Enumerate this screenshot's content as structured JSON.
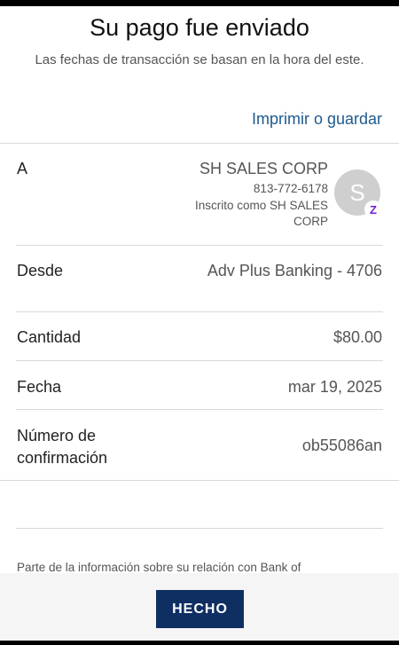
{
  "header": {
    "title": "Su pago fue enviado",
    "subtitle": "Las fechas de transacción se basan en la hora del este."
  },
  "actions": {
    "print_label": "Imprimir o guardar",
    "done_label": "HECHO"
  },
  "details": {
    "recipient": {
      "label": "A",
      "name": "SH SALES CORP",
      "phone": "813-772-6178",
      "enrolled_line1": "Inscrito como SH SALES",
      "enrolled_line2": "CORP",
      "avatar_initial": "S",
      "badge_letter": "Z"
    },
    "from": {
      "label": "Desde",
      "value": "Adv Plus Banking - 4706"
    },
    "amount": {
      "label": "Cantidad",
      "value": "$80.00"
    },
    "date": {
      "label": "Fecha",
      "value": "mar 19, 2025"
    },
    "confirmation": {
      "label_line1": "Número de",
      "label_line2": "confirmación",
      "value": "ob55086an"
    }
  },
  "disclaimer": "Parte de la información sobre su relación con Bank of",
  "colors": {
    "link": "#1e5a8e",
    "button": "#0f2f63",
    "zelle": "#6d1ed4",
    "avatar": "#cfcfcf"
  }
}
